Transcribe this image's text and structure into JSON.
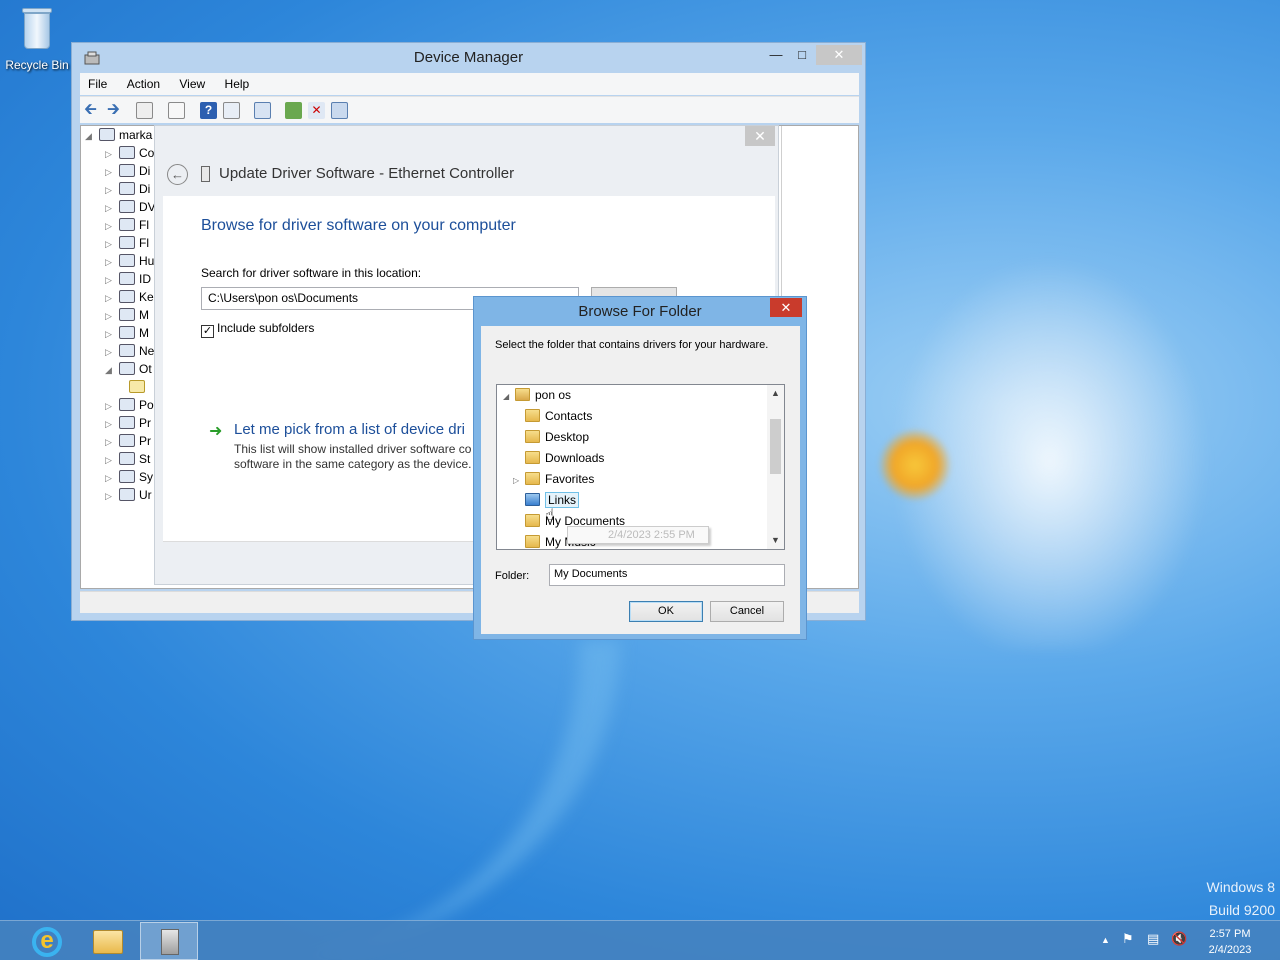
{
  "desktop": {
    "recycle_bin_label": "Recycle Bin",
    "watermark_line1": "Windows 8",
    "watermark_line2": "Build 9200"
  },
  "device_manager": {
    "title": "Device Manager",
    "menu": [
      "File",
      "Action",
      "View",
      "Help"
    ],
    "tree_root": "marka",
    "tree_items": [
      "Co",
      "Di",
      "Di",
      "DV",
      "Fl",
      "Fl",
      "Hu",
      "ID",
      "Ke",
      "M",
      "M",
      "Ne",
      "Ot",
      "",
      "Po",
      "Pr",
      "Pr",
      "St",
      "Sy",
      "Ur"
    ]
  },
  "update_driver": {
    "heading": "Update Driver Software - Ethernet Controller",
    "subheading": "Browse for driver software on your computer",
    "search_label": "Search for driver software in this location:",
    "path_value": "C:\\Users\\pon os\\Documents",
    "include_subfolders": "Include subfolders",
    "pick_title": "Let me pick from a list of device dri",
    "pick_desc_line1": "This list will show installed driver software co",
    "pick_desc_line2": "software in the same category as the device."
  },
  "browse_folder": {
    "title": "Browse For Folder",
    "description": "Select the folder that contains drivers for your hardware.",
    "tree": {
      "root": "pon os",
      "items": [
        "Contacts",
        "Desktop",
        "Downloads",
        "Favorites",
        "Links",
        "My Documents",
        "My Music"
      ]
    },
    "tooltip": "2/4/2023 2:55 PM",
    "folder_label": "Folder:",
    "folder_value": "My Documents",
    "ok_label": "OK",
    "cancel_label": "Cancel"
  },
  "taskbar": {
    "time": "2:57 PM",
    "date": "2/4/2023"
  },
  "colors": {
    "accent_blue": "#1d4f9a",
    "close_red": "#c93b2c",
    "dialog_frame": "#7fb5e6"
  }
}
